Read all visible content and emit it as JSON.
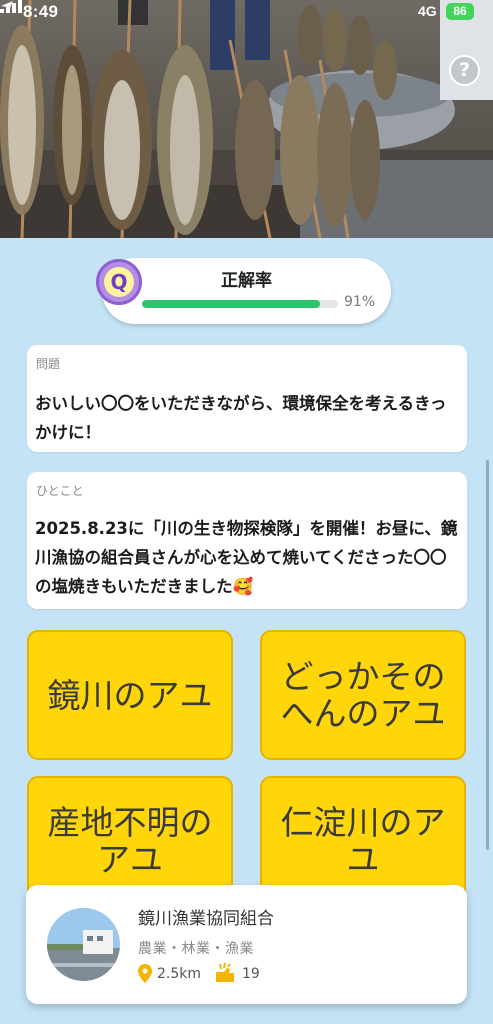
{
  "status_bar": {
    "time": "8:49",
    "network": "4G",
    "battery": "86"
  },
  "hero": {
    "photo": "grilled-ayu-skewers-photo",
    "help_label": "?"
  },
  "accuracy": {
    "badge": "Q",
    "title": "正解率",
    "percent_label": "91%",
    "value": 0.91
  },
  "question": {
    "label": "問題",
    "text": "おいしい〇〇をいただきながら、環境保全を考えるきっかけに！"
  },
  "comment": {
    "label": "ひとこと",
    "text": "2025.8.23に「川の生き物探検隊」を開催！お昼に、鏡川漁協の組合員さんが心を込めて焼いてくださった〇〇の塩焼きもいただきました🥰"
  },
  "answers": [
    {
      "label": "鏡川のアユ"
    },
    {
      "label": "どっかそのへんのアユ"
    },
    {
      "label": "産地不明のアユ"
    },
    {
      "label": "仁淀川のアユ"
    }
  ],
  "organization": {
    "name": "鏡川漁業協同組合",
    "category": "農業・林業・漁業",
    "distance": "2.5km",
    "claps": "19"
  },
  "colors": {
    "background": "#c5e3f7",
    "answer_yellow": "#ffd60a",
    "progress_green": "#2dc46e",
    "badge_purple": "#8e5fd3"
  }
}
